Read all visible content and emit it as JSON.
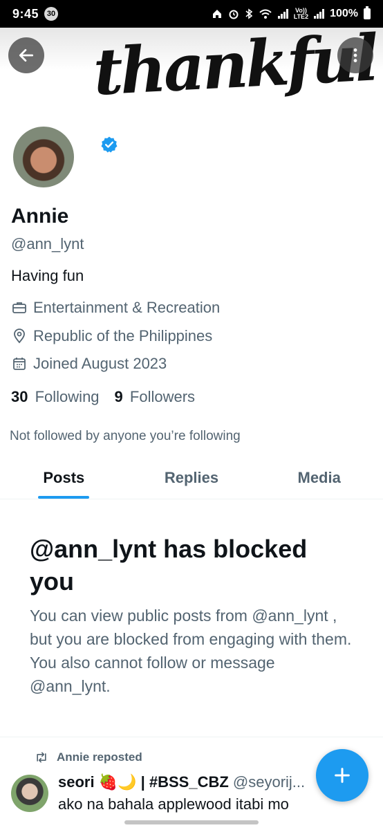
{
  "status_bar": {
    "time": "9:45",
    "notification_count": "30",
    "network_label_top": "Vo))",
    "network_label_bottom": "LTE2",
    "battery": "100%"
  },
  "banner": {
    "text": "thankful"
  },
  "profile": {
    "name": "Annie",
    "handle": "@ann_lynt",
    "bio": "Having fun",
    "category": "Entertainment & Recreation",
    "location": "Republic of the Philippines",
    "joined": "Joined August 2023",
    "following_count": "30",
    "following_label": "Following",
    "followers_count": "9",
    "followers_label": "Followers",
    "not_followed_text": "Not followed by anyone you’re following"
  },
  "tabs": [
    {
      "label": "Posts",
      "active": true
    },
    {
      "label": "Replies",
      "active": false
    },
    {
      "label": "Media",
      "active": false
    }
  ],
  "blocked": {
    "title": "@ann_lynt has blocked you",
    "message": "You can view public posts from @ann_lynt , but you are blocked from engaging with them. You also cannot follow or message @ann_lynt."
  },
  "repost": {
    "label": "Annie reposted",
    "author_name": "seori 🍓🌙 | #BSS_CBZ",
    "author_handle": "@seyorij...",
    "text": "ako na bahala applewood itabi mo"
  },
  "colors": {
    "accent": "#1d9bf0",
    "secondary_text": "#536471",
    "primary_text": "#0f1419"
  }
}
